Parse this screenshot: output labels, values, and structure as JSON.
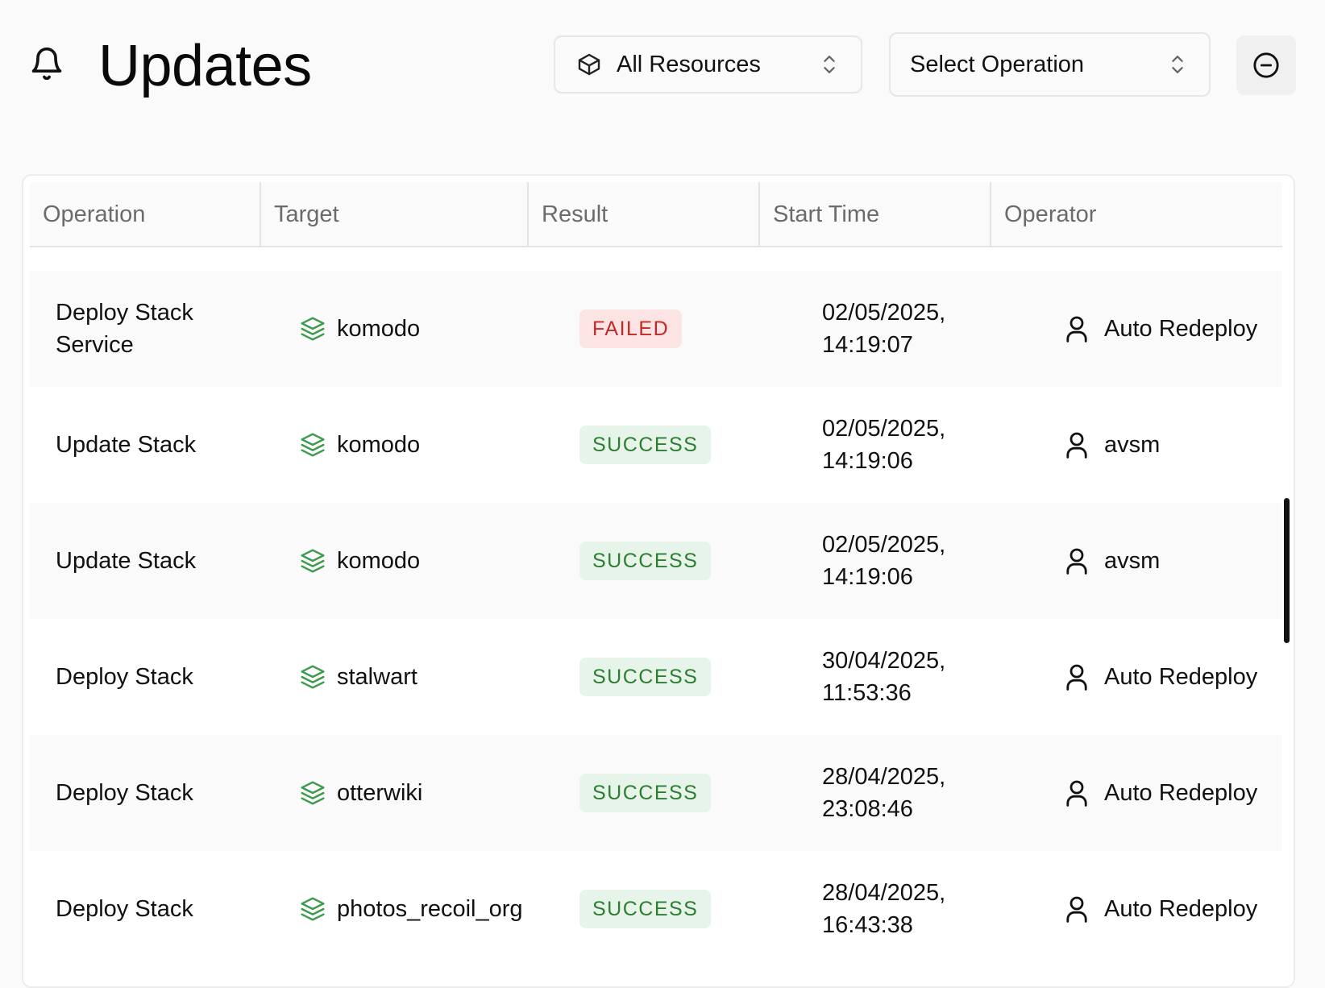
{
  "header": {
    "title": "Updates",
    "resource_filter": "All Resources",
    "operation_filter": "Select Operation"
  },
  "table": {
    "columns": [
      "Operation",
      "Target",
      "Result",
      "Start Time",
      "Operator"
    ],
    "rows": [
      {
        "operation": "Deploy Stack Service",
        "target": "komodo",
        "result": "FAILED",
        "start_date": "02/05/2025,",
        "start_time": "14:19:07",
        "operator": "Auto Redeploy"
      },
      {
        "operation": "Update Stack",
        "target": "komodo",
        "result": "SUCCESS",
        "start_date": "02/05/2025,",
        "start_time": "14:19:06",
        "operator": "avsm"
      },
      {
        "operation": "Update Stack",
        "target": "komodo",
        "result": "SUCCESS",
        "start_date": "02/05/2025,",
        "start_time": "14:19:06",
        "operator": "avsm"
      },
      {
        "operation": "Deploy Stack",
        "target": "stalwart",
        "result": "SUCCESS",
        "start_date": "30/04/2025,",
        "start_time": "11:53:36",
        "operator": "Auto Redeploy"
      },
      {
        "operation": "Deploy Stack",
        "target": "otterwiki",
        "result": "SUCCESS",
        "start_date": "28/04/2025,",
        "start_time": "23:08:46",
        "operator": "Auto Redeploy"
      },
      {
        "operation": "Deploy Stack",
        "target": "photos_recoil_org",
        "result": "SUCCESS",
        "start_date": "28/04/2025,",
        "start_time": "16:43:38",
        "operator": "Auto Redeploy"
      }
    ]
  },
  "colors": {
    "success_bg": "#e6f4ea",
    "success_text": "#2e7d32",
    "failed_bg": "#fde4e4",
    "failed_text": "#c62828",
    "stack_icon": "#3a9a4a"
  },
  "icons": {
    "header": "bell-icon",
    "resource_filter": "box-icon",
    "dropdown": "chevrons-up-down-icon",
    "clear_button": "minus-circle-icon",
    "target": "layers-icon",
    "operator": "user-icon"
  }
}
